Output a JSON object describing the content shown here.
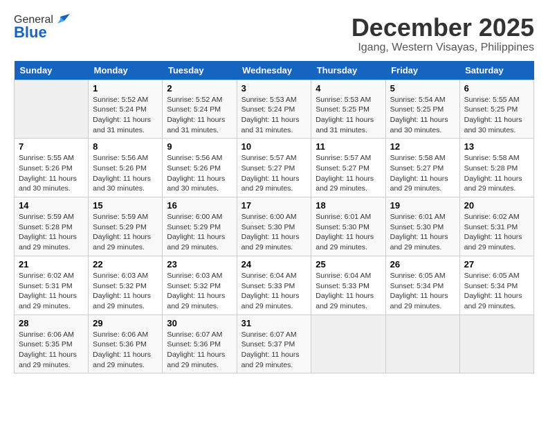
{
  "logo": {
    "general": "General",
    "blue": "Blue"
  },
  "title": "December 2025",
  "subtitle": "Igang, Western Visayas, Philippines",
  "days_header": [
    "Sunday",
    "Monday",
    "Tuesday",
    "Wednesday",
    "Thursday",
    "Friday",
    "Saturday"
  ],
  "weeks": [
    [
      {
        "day": "",
        "info": ""
      },
      {
        "day": "1",
        "info": "Sunrise: 5:52 AM\nSunset: 5:24 PM\nDaylight: 11 hours and 31 minutes."
      },
      {
        "day": "2",
        "info": "Sunrise: 5:52 AM\nSunset: 5:24 PM\nDaylight: 11 hours and 31 minutes."
      },
      {
        "day": "3",
        "info": "Sunrise: 5:53 AM\nSunset: 5:24 PM\nDaylight: 11 hours and 31 minutes."
      },
      {
        "day": "4",
        "info": "Sunrise: 5:53 AM\nSunset: 5:25 PM\nDaylight: 11 hours and 31 minutes."
      },
      {
        "day": "5",
        "info": "Sunrise: 5:54 AM\nSunset: 5:25 PM\nDaylight: 11 hours and 30 minutes."
      },
      {
        "day": "6",
        "info": "Sunrise: 5:55 AM\nSunset: 5:25 PM\nDaylight: 11 hours and 30 minutes."
      }
    ],
    [
      {
        "day": "7",
        "info": "Sunrise: 5:55 AM\nSunset: 5:26 PM\nDaylight: 11 hours and 30 minutes."
      },
      {
        "day": "8",
        "info": "Sunrise: 5:56 AM\nSunset: 5:26 PM\nDaylight: 11 hours and 30 minutes."
      },
      {
        "day": "9",
        "info": "Sunrise: 5:56 AM\nSunset: 5:26 PM\nDaylight: 11 hours and 30 minutes."
      },
      {
        "day": "10",
        "info": "Sunrise: 5:57 AM\nSunset: 5:27 PM\nDaylight: 11 hours and 29 minutes."
      },
      {
        "day": "11",
        "info": "Sunrise: 5:57 AM\nSunset: 5:27 PM\nDaylight: 11 hours and 29 minutes."
      },
      {
        "day": "12",
        "info": "Sunrise: 5:58 AM\nSunset: 5:27 PM\nDaylight: 11 hours and 29 minutes."
      },
      {
        "day": "13",
        "info": "Sunrise: 5:58 AM\nSunset: 5:28 PM\nDaylight: 11 hours and 29 minutes."
      }
    ],
    [
      {
        "day": "14",
        "info": "Sunrise: 5:59 AM\nSunset: 5:28 PM\nDaylight: 11 hours and 29 minutes."
      },
      {
        "day": "15",
        "info": "Sunrise: 5:59 AM\nSunset: 5:29 PM\nDaylight: 11 hours and 29 minutes."
      },
      {
        "day": "16",
        "info": "Sunrise: 6:00 AM\nSunset: 5:29 PM\nDaylight: 11 hours and 29 minutes."
      },
      {
        "day": "17",
        "info": "Sunrise: 6:00 AM\nSunset: 5:30 PM\nDaylight: 11 hours and 29 minutes."
      },
      {
        "day": "18",
        "info": "Sunrise: 6:01 AM\nSunset: 5:30 PM\nDaylight: 11 hours and 29 minutes."
      },
      {
        "day": "19",
        "info": "Sunrise: 6:01 AM\nSunset: 5:30 PM\nDaylight: 11 hours and 29 minutes."
      },
      {
        "day": "20",
        "info": "Sunrise: 6:02 AM\nSunset: 5:31 PM\nDaylight: 11 hours and 29 minutes."
      }
    ],
    [
      {
        "day": "21",
        "info": "Sunrise: 6:02 AM\nSunset: 5:31 PM\nDaylight: 11 hours and 29 minutes."
      },
      {
        "day": "22",
        "info": "Sunrise: 6:03 AM\nSunset: 5:32 PM\nDaylight: 11 hours and 29 minutes."
      },
      {
        "day": "23",
        "info": "Sunrise: 6:03 AM\nSunset: 5:32 PM\nDaylight: 11 hours and 29 minutes."
      },
      {
        "day": "24",
        "info": "Sunrise: 6:04 AM\nSunset: 5:33 PM\nDaylight: 11 hours and 29 minutes."
      },
      {
        "day": "25",
        "info": "Sunrise: 6:04 AM\nSunset: 5:33 PM\nDaylight: 11 hours and 29 minutes."
      },
      {
        "day": "26",
        "info": "Sunrise: 6:05 AM\nSunset: 5:34 PM\nDaylight: 11 hours and 29 minutes."
      },
      {
        "day": "27",
        "info": "Sunrise: 6:05 AM\nSunset: 5:34 PM\nDaylight: 11 hours and 29 minutes."
      }
    ],
    [
      {
        "day": "28",
        "info": "Sunrise: 6:06 AM\nSunset: 5:35 PM\nDaylight: 11 hours and 29 minutes."
      },
      {
        "day": "29",
        "info": "Sunrise: 6:06 AM\nSunset: 5:36 PM\nDaylight: 11 hours and 29 minutes."
      },
      {
        "day": "30",
        "info": "Sunrise: 6:07 AM\nSunset: 5:36 PM\nDaylight: 11 hours and 29 minutes."
      },
      {
        "day": "31",
        "info": "Sunrise: 6:07 AM\nSunset: 5:37 PM\nDaylight: 11 hours and 29 minutes."
      },
      {
        "day": "",
        "info": ""
      },
      {
        "day": "",
        "info": ""
      },
      {
        "day": "",
        "info": ""
      }
    ]
  ]
}
